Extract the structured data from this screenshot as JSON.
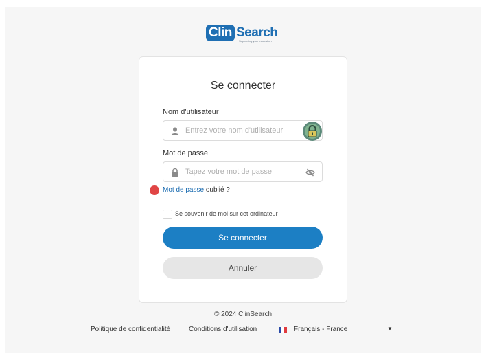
{
  "logo": {
    "part1": "Clin",
    "part2": "Search",
    "tagline": "Supporting your innovation"
  },
  "login": {
    "title": "Se connecter",
    "username": {
      "label": "Nom d'utilisateur",
      "placeholder": "Entrez votre nom d'utilisateur",
      "lead_icon": "user-icon",
      "trailing_icon": "password-manager-icon"
    },
    "password": {
      "label": "Mot de passe",
      "placeholder": "Tapez votre mot de passe",
      "lead_icon": "lock-icon",
      "trailing_icon": "eye-slash-icon"
    },
    "forgot": {
      "link": "Mot de passe",
      "rest": " oublié ?"
    },
    "remember": "Se souvenir de moi sur cet ordinateur",
    "submit": "Se connecter",
    "cancel": "Annuler"
  },
  "footer": {
    "copyright": "© 2024 ClinSearch",
    "privacy": "Politique de confidentialité",
    "terms": "Conditions d'utilisation",
    "language": "Français - France",
    "language_flag": "flag-fr-icon",
    "language_caret": "caret-down-icon"
  },
  "colors": {
    "brand": "#1f6fb3",
    "primary_button": "#1c7fc4",
    "secondary_button": "#e6e6e6",
    "link": "#1a6bb0",
    "marker": "#e04545"
  }
}
